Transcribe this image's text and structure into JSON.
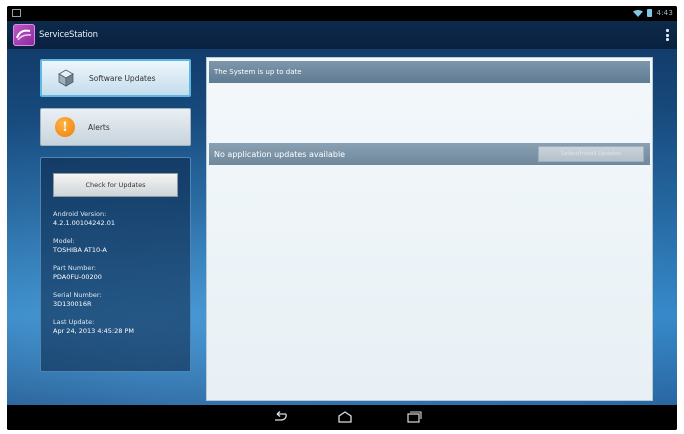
{
  "status_bar": {
    "time": "4:43"
  },
  "app": {
    "title": "ServiceStation"
  },
  "nav": {
    "software_updates": "Software Updates",
    "alerts": "Alerts"
  },
  "info": {
    "check_button": "Check for Updates",
    "items": [
      {
        "label": "Android Version:",
        "value": "4.2.1.00104242.01"
      },
      {
        "label": "Model:",
        "value": "TOSHIBA AT10-A"
      },
      {
        "label": "Part Number:",
        "value": "PDA0FU-00200"
      },
      {
        "label": "Serial Number:",
        "value": "3D130016R"
      },
      {
        "label": "Last Update:",
        "value": "Apr 24, 2013 4:45:28 PM"
      }
    ]
  },
  "main": {
    "system_status": "The System is up to date",
    "app_status": "No application updates available",
    "install_button": "Select/Install Updates"
  },
  "colors": {
    "action_bar": "#0c2a4b",
    "accent": "#5fb7e6",
    "section_bar": "#6f889c"
  }
}
